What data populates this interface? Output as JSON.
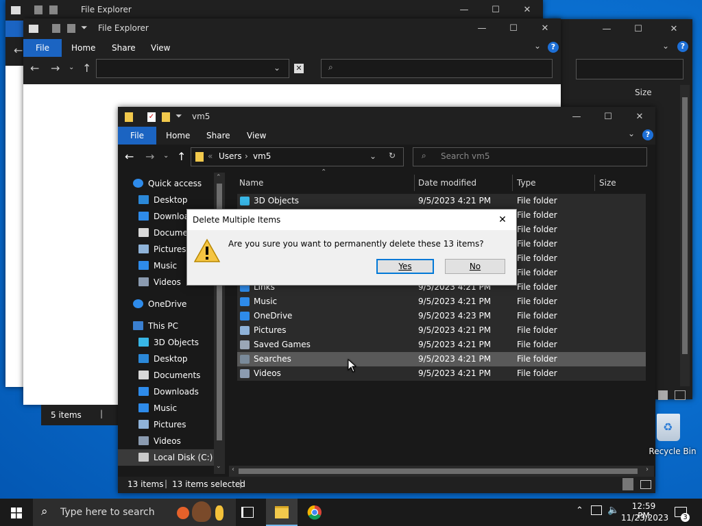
{
  "colors": {
    "accent": "#1b64c2",
    "folder": "#f2c94c",
    "dialog_bg": "#f0f0f0",
    "selected_row": "#595959"
  },
  "back_window_1": {
    "title": "File Explorer",
    "status_items": "5 items"
  },
  "back_window_2": {
    "title": "File Explorer",
    "tabs": {
      "file": "File",
      "home": "Home",
      "share": "Share",
      "view": "View"
    },
    "help": "?"
  },
  "back_window_3": {
    "size_header": "Size",
    "help": "?"
  },
  "main_window": {
    "title": "vm5",
    "tabs": {
      "file": "File",
      "home": "Home",
      "share": "Share",
      "view": "View"
    },
    "help": "?",
    "breadcrumb": {
      "chev": "«",
      "users": "Users",
      "sep": "›",
      "current": "vm5"
    },
    "search_placeholder": "Search vm5",
    "columns": {
      "name": "Name",
      "date": "Date modified",
      "type": "Type",
      "size": "Size"
    },
    "nav": [
      {
        "label": "Quick access",
        "icon": "star-icon"
      },
      {
        "label": "Desktop",
        "icon": "desktop-icon"
      },
      {
        "label": "Downloads",
        "icon": "download-icon"
      },
      {
        "label": "Documents",
        "icon": "document-icon"
      },
      {
        "label": "Pictures",
        "icon": "pictures-icon"
      },
      {
        "label": "Music",
        "icon": "music-icon"
      },
      {
        "label": "Videos",
        "icon": "videos-icon"
      },
      {
        "label": "OneDrive",
        "icon": "cloud-icon"
      },
      {
        "label": "This PC",
        "icon": "pc-icon"
      },
      {
        "label": "3D Objects",
        "icon": "cube-icon"
      },
      {
        "label": "Desktop",
        "icon": "desktop-icon"
      },
      {
        "label": "Documents",
        "icon": "document-icon"
      },
      {
        "label": "Downloads",
        "icon": "download-icon"
      },
      {
        "label": "Music",
        "icon": "music-icon"
      },
      {
        "label": "Pictures",
        "icon": "pictures-icon"
      },
      {
        "label": "Videos",
        "icon": "videos-icon"
      },
      {
        "label": "Local Disk (C:)",
        "icon": "disk-icon"
      }
    ],
    "rows": [
      {
        "name": "3D Objects",
        "date": "9/5/2023 4:21 PM",
        "type": "File folder"
      },
      {
        "name": "",
        "date": "",
        "type": "File folder"
      },
      {
        "name": "",
        "date": "",
        "type": "File folder"
      },
      {
        "name": "",
        "date": "",
        "type": "File folder"
      },
      {
        "name": "",
        "date": "",
        "type": "File folder"
      },
      {
        "name": "",
        "date": "",
        "type": "File folder"
      },
      {
        "name": "Links",
        "date": "9/5/2023 4:21 PM",
        "type": "File folder"
      },
      {
        "name": "Music",
        "date": "9/5/2023 4:21 PM",
        "type": "File folder"
      },
      {
        "name": "OneDrive",
        "date": "9/5/2023 4:23 PM",
        "type": "File folder"
      },
      {
        "name": "Pictures",
        "date": "9/5/2023 4:21 PM",
        "type": "File folder"
      },
      {
        "name": "Saved Games",
        "date": "9/5/2023 4:21 PM",
        "type": "File folder"
      },
      {
        "name": "Searches",
        "date": "9/5/2023 4:21 PM",
        "type": "File folder"
      },
      {
        "name": "Videos",
        "date": "9/5/2023 4:21 PM",
        "type": "File folder"
      }
    ],
    "status": {
      "items": "13 items",
      "selected": "13 items selected"
    }
  },
  "dialog": {
    "title": "Delete Multiple Items",
    "message": "Are you sure you want to permanently delete these 13 items?",
    "yes": "Yes",
    "no": "No"
  },
  "desktop": {
    "recycle_bin": "Recycle Bin"
  },
  "taskbar": {
    "search_placeholder": "Type here to search",
    "time": "12:59 PM",
    "date": "11/23/2023",
    "notification_count": "3"
  }
}
